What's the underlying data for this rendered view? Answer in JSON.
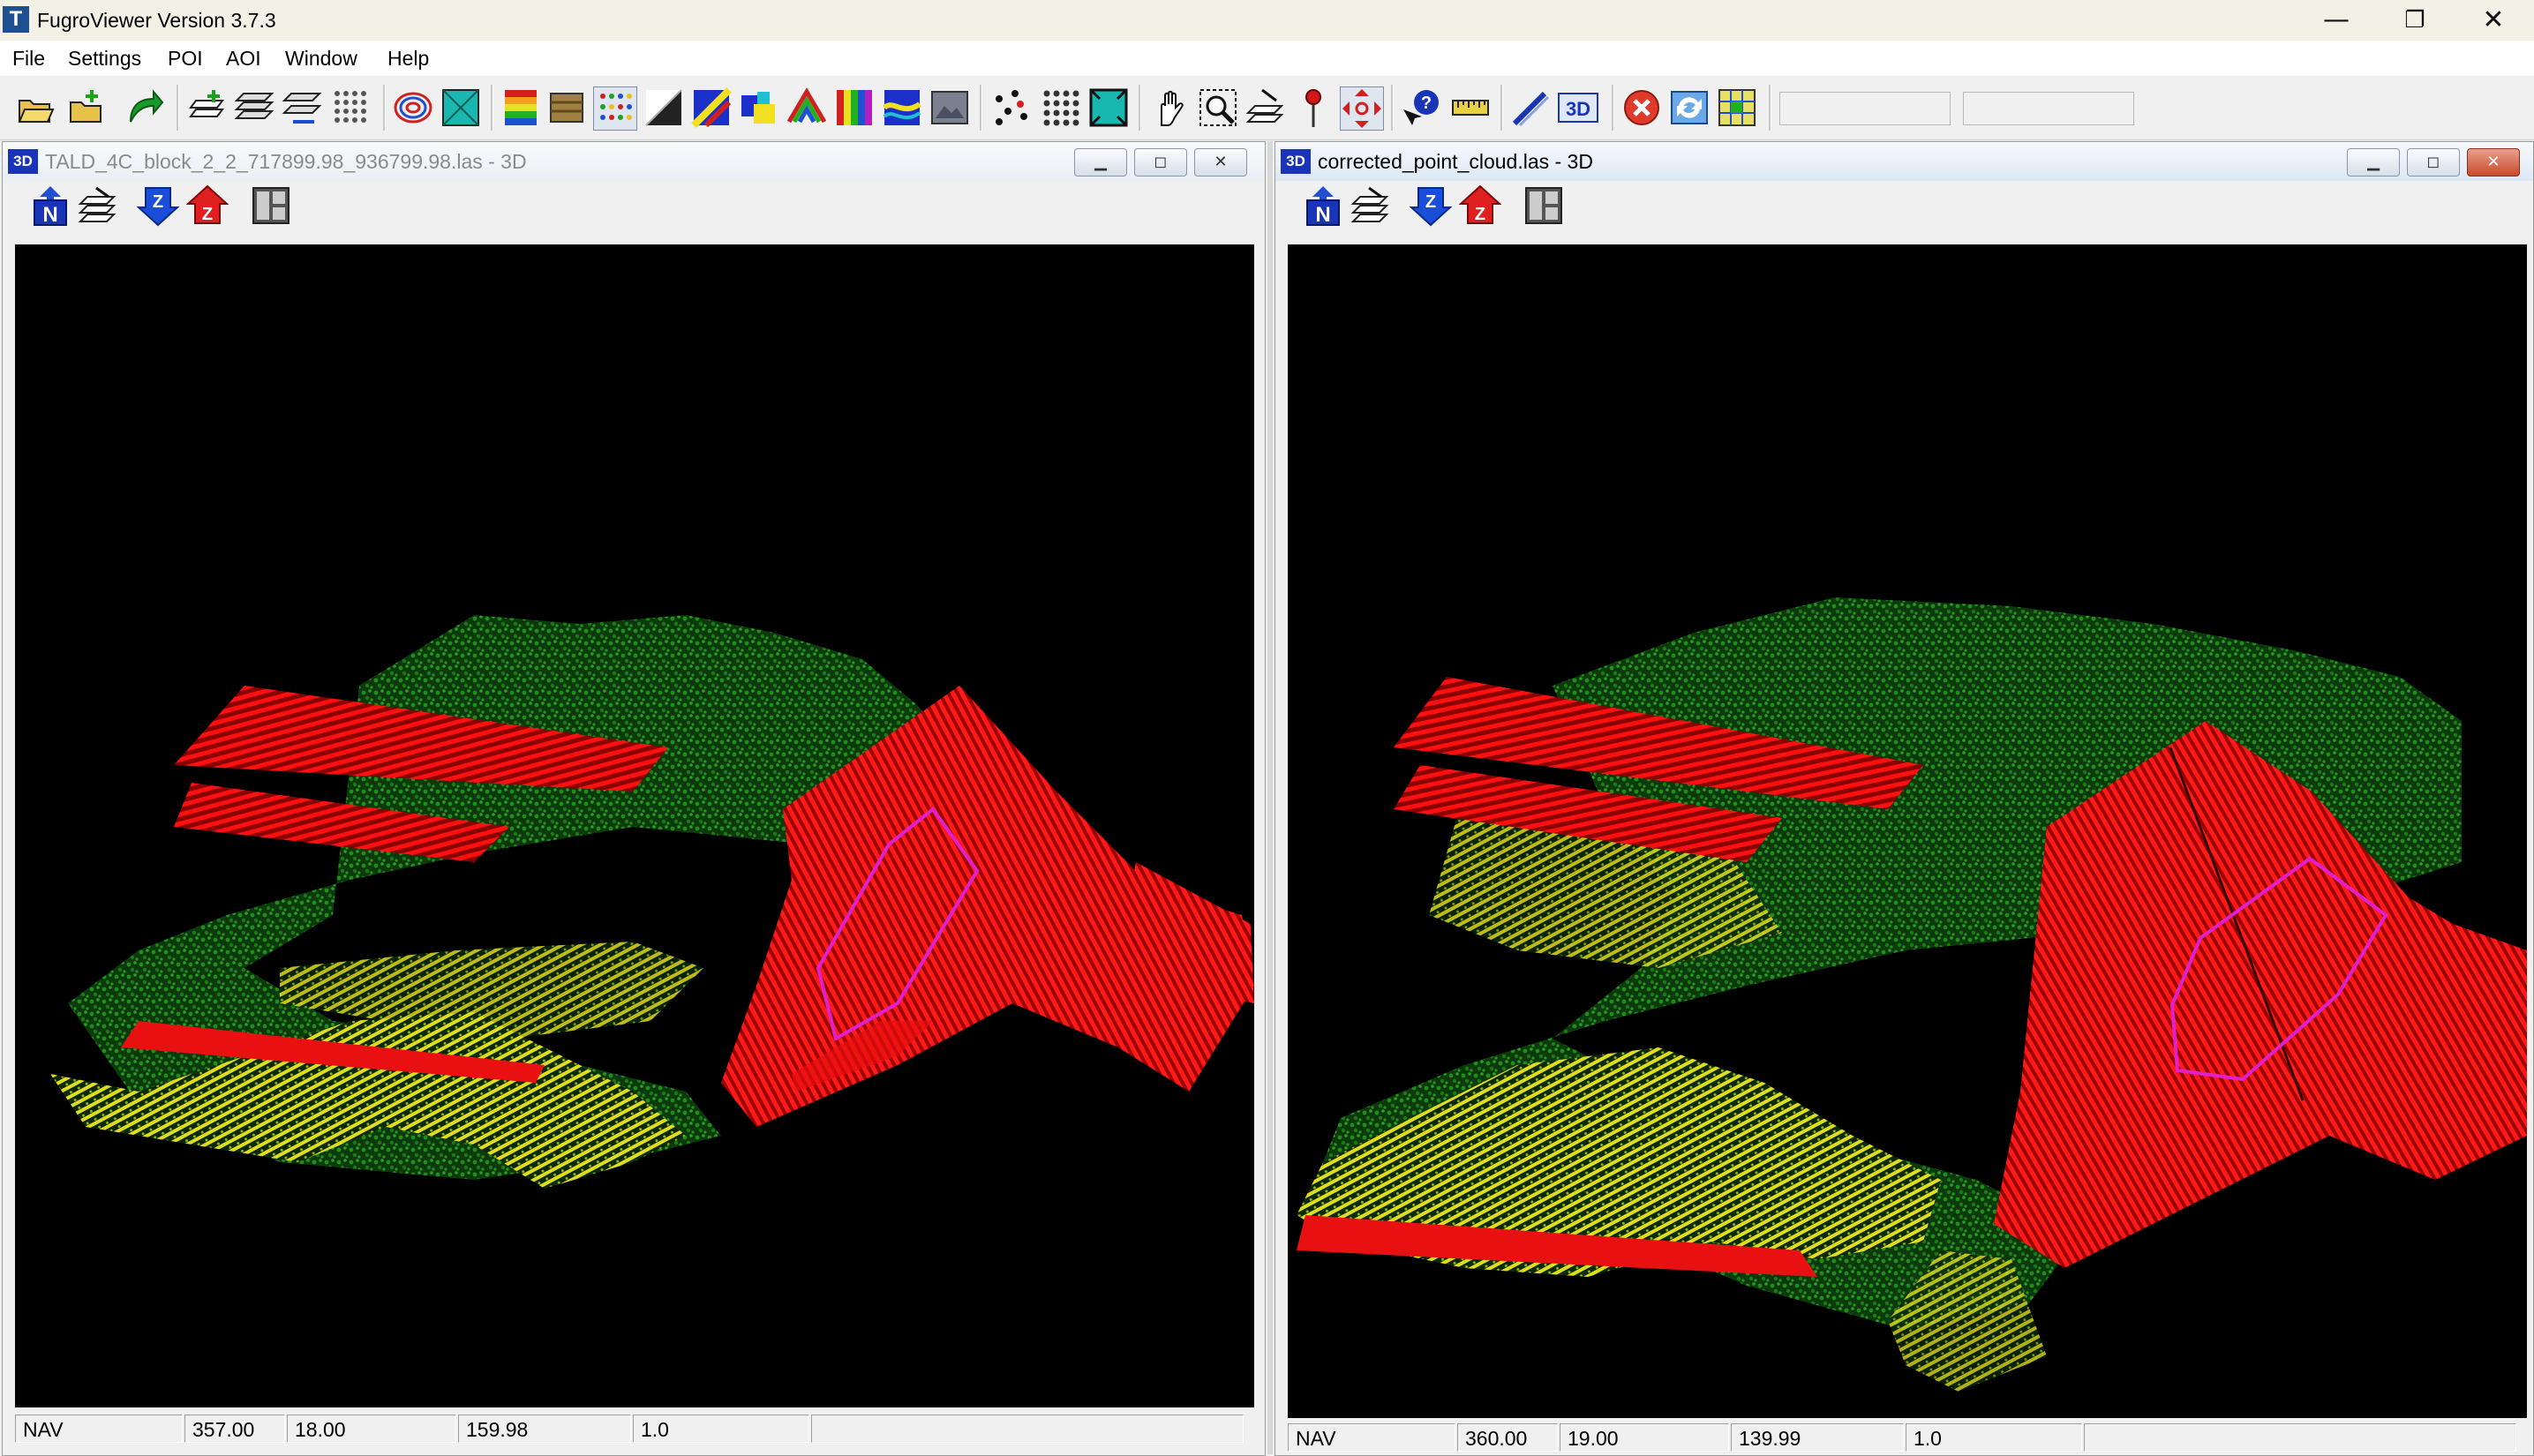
{
  "app": {
    "title": "FugroViewer  Version 3.7.3",
    "icon_letter": "T",
    "window_controls": {
      "minimize": "—",
      "restore": "❐",
      "close": "✕"
    }
  },
  "menu": [
    {
      "label": "File"
    },
    {
      "label": "Settings"
    },
    {
      "label": "POI"
    },
    {
      "label": "AOI"
    },
    {
      "label": "Window"
    },
    {
      "label": "Help"
    }
  ],
  "toolbar_icons": [
    "open-folder-icon",
    "open-add-icon",
    "redo-arrow-icon",
    "add-layer-icon",
    "layers-icon",
    "layers-swap-icon",
    "point-grid-icon",
    "contour-icon",
    "tin-surface-icon",
    "elevation-ramp-icon",
    "intensity-icon",
    "classification-icon",
    "slope-icon",
    "color-rgb-icon",
    "color-return-icon",
    "color-rainbow-icon",
    "color-bars-icon",
    "color-flight-icon",
    "color-image-icon",
    "points-icon",
    "point-matrix-icon",
    "surface-fill-icon",
    "pan-hand-icon",
    "zoom-box-icon",
    "profile-icon",
    "poi-pin-icon",
    "center-target-icon",
    "identify-icon",
    "measure-ruler-icon",
    "draw-line-icon",
    "view-3d-icon",
    "stop-icon",
    "refresh-icon",
    "grid-map-icon"
  ],
  "windows": [
    {
      "title": "TALD_4C_block_2_2_717899.98_936799.98.las - 3D",
      "icon_label": "3D",
      "active": false,
      "subtoolbar": [
        "north-up-icon",
        "layer-stack-icon",
        "z-down-icon",
        "z-up-icon",
        "split-view-icon"
      ],
      "status": [
        "NAV",
        "357.00",
        "18.00",
        "159.98",
        "1.0",
        ""
      ]
    },
    {
      "title": "corrected_point_cloud.las - 3D",
      "icon_label": "3D",
      "active": true,
      "subtoolbar": [
        "north-up-icon",
        "layer-stack-icon",
        "z-down-icon",
        "z-up-icon",
        "split-view-icon"
      ],
      "status": [
        "NAV",
        "360.00",
        "19.00",
        "139.99",
        "1.0",
        ""
      ]
    }
  ],
  "colors": {
    "buildings": "#ff0000",
    "vegetation": "#1f8f1a",
    "ground": "#e6e61a",
    "aoi_outline": "#e020d0",
    "background": "#000000"
  }
}
